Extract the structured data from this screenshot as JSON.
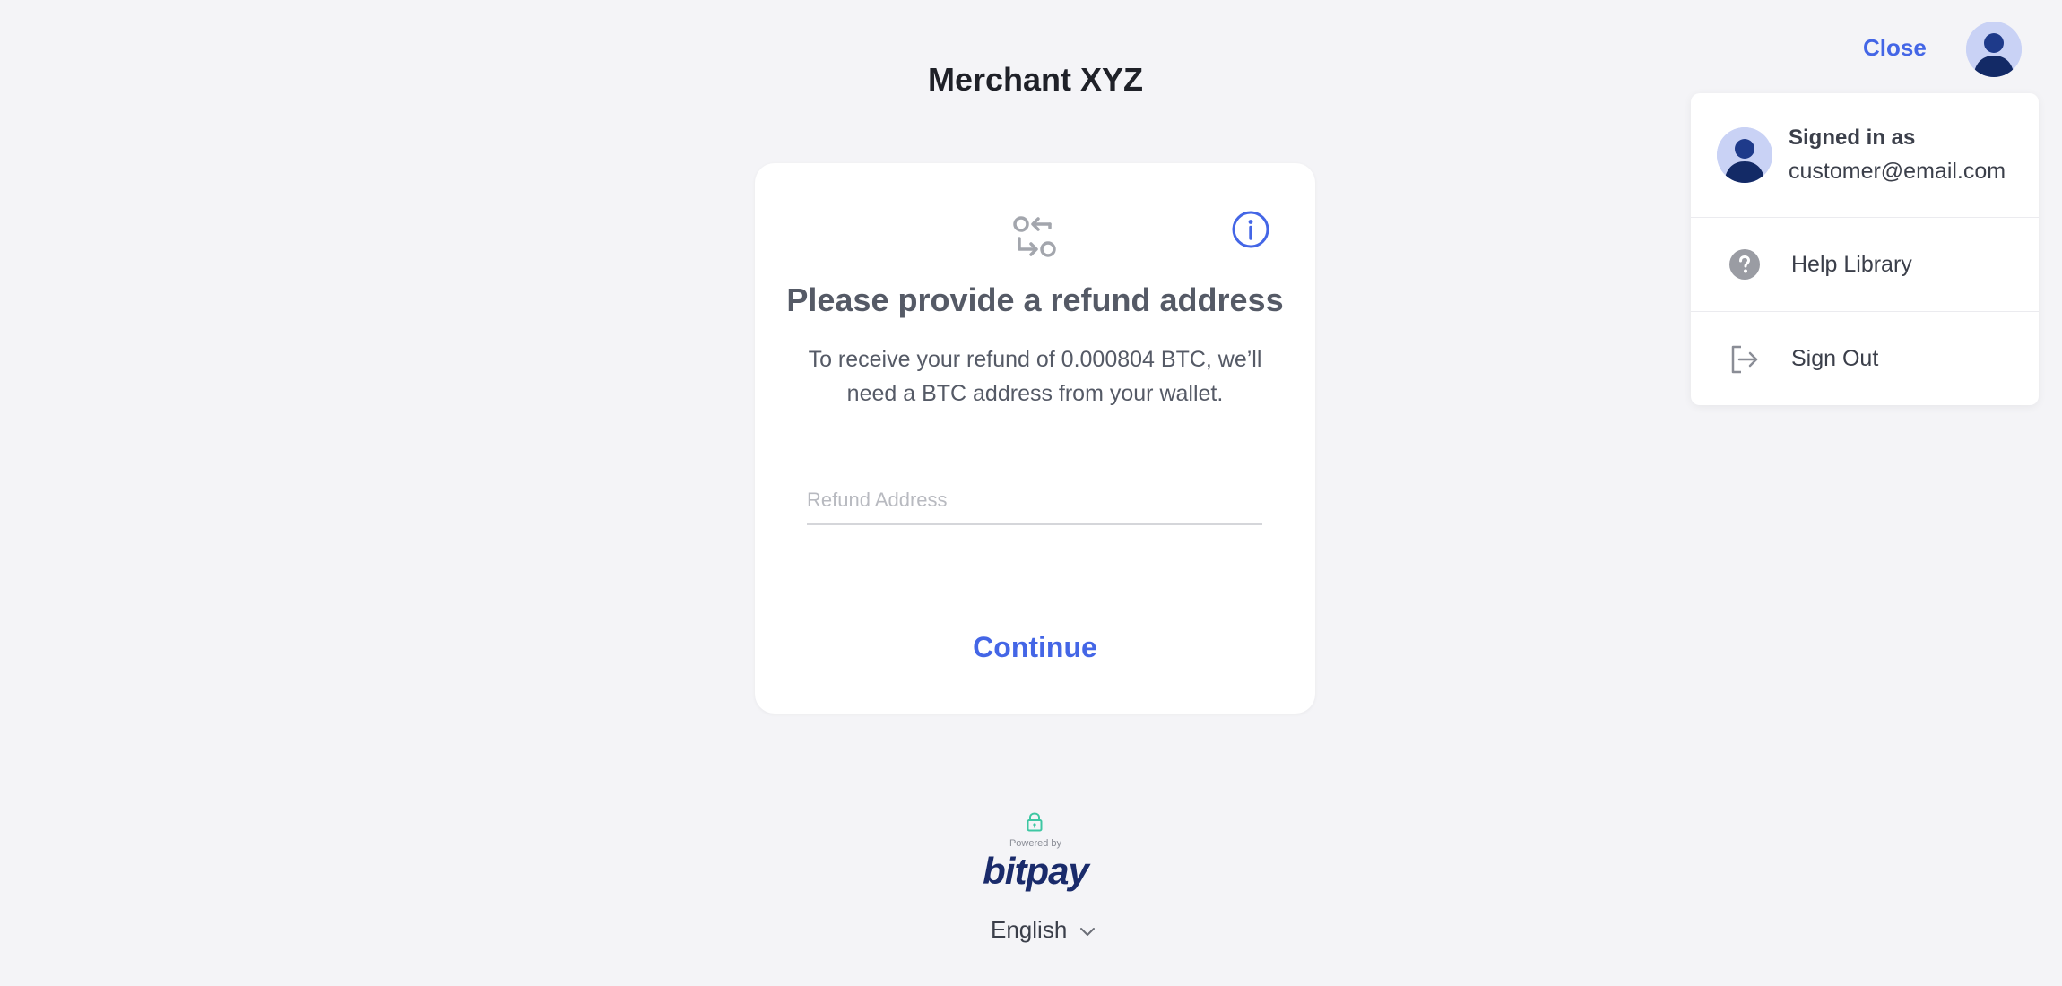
{
  "header": {
    "merchant_name": "Merchant XYZ",
    "close_label": "Close"
  },
  "user_menu": {
    "signed_in_label": "Signed in as",
    "email": "customer@email.com",
    "items": [
      {
        "label": "Help Library",
        "icon": "help-circle-icon"
      },
      {
        "label": "Sign Out",
        "icon": "sign-out-icon"
      }
    ]
  },
  "card": {
    "title": "Please provide a refund address",
    "description": "To receive your refund of 0.000804 BTC, we’ll need a BTC address from your wallet.",
    "input_placeholder": "Refund Address",
    "input_value": "",
    "continue_label": "Continue",
    "icons": [
      "swap-icon",
      "info-icon"
    ]
  },
  "footer": {
    "powered_by": "Powered by",
    "brand": "bitpay",
    "language": "English"
  },
  "colors": {
    "accent": "#4466e6",
    "background": "#f4f4f7",
    "brand": "#1a2b6b",
    "lock": "#3ec7a3"
  }
}
